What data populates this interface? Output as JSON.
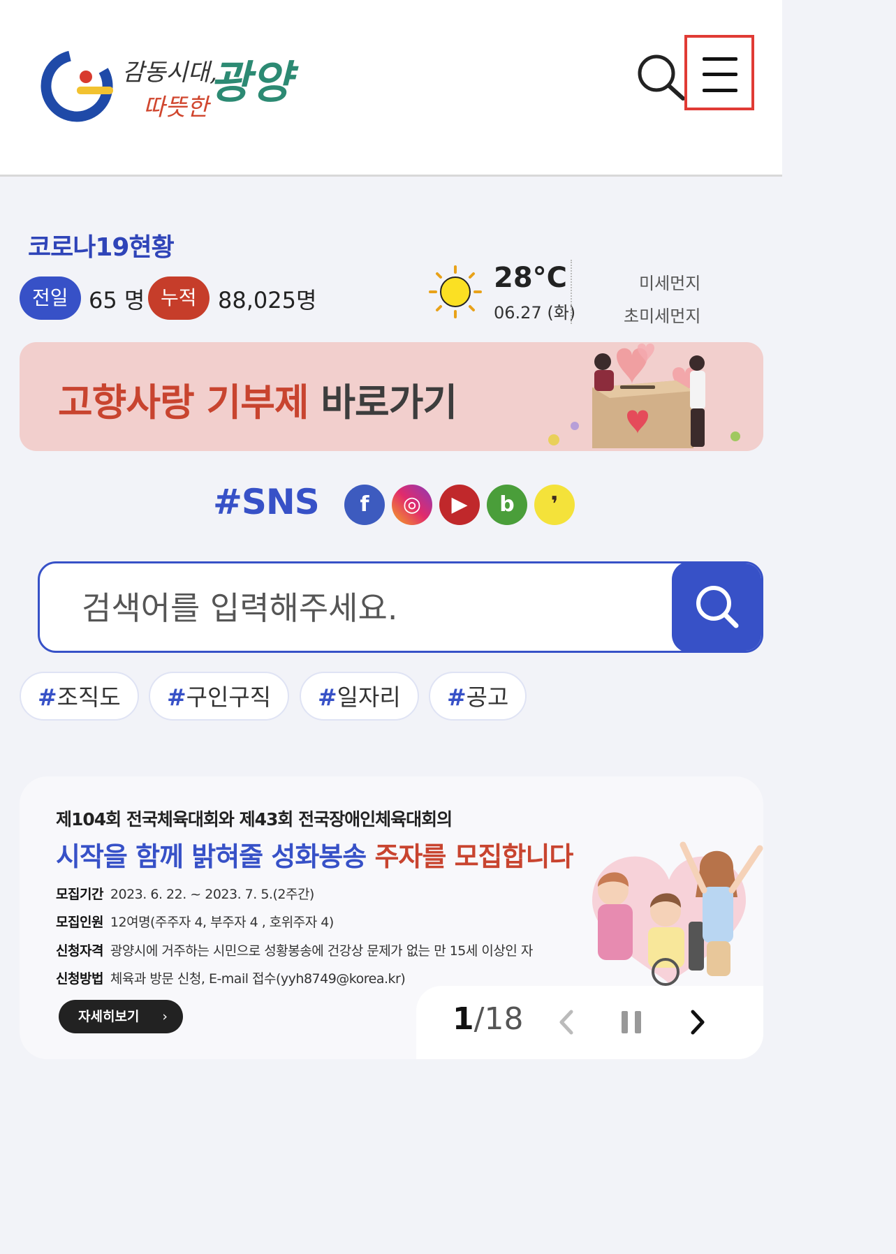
{
  "header": {
    "logo_text": "감동시대, 따뜻한 광양"
  },
  "covid": {
    "title": "코로나19현황",
    "prev_label": "전일",
    "prev_value": "65 명",
    "total_label": "누적",
    "total_value": "88,025명"
  },
  "weather": {
    "temp": "28°C",
    "date": "06.27 (화)",
    "fine_dust_label": "미세먼지",
    "ultra_fine_dust_label": "초미세먼지"
  },
  "gohyang_banner": {
    "text_red": "고향사랑 기부제",
    "text_gray": " 바로가기"
  },
  "sns": {
    "title": "#SNS",
    "items": [
      {
        "name": "facebook",
        "glyph": "f"
      },
      {
        "name": "instagram",
        "glyph": "◎"
      },
      {
        "name": "youtube",
        "glyph": "▶"
      },
      {
        "name": "blog",
        "glyph": "b"
      },
      {
        "name": "kakao",
        "glyph": "❜"
      }
    ]
  },
  "search": {
    "placeholder": "검색어를 입력해주세요."
  },
  "tags": [
    {
      "hash": "#",
      "label": "조직도"
    },
    {
      "hash": "#",
      "label": "구인구직"
    },
    {
      "hash": "#",
      "label": "일자리"
    },
    {
      "hash": "#",
      "label": "공고"
    }
  ],
  "main_banner": {
    "subtitle": "제104회 전국체육대회와 제43회 전국장애인체육대회의",
    "title_blue": "시작을 함께 밝혀줄 성화봉송 ",
    "title_red": "주자를 모집합니다",
    "rows": [
      {
        "label": "모집기간",
        "value": "2023. 6. 22. ~ 2023. 7. 5.(2주간)"
      },
      {
        "label": "모집인원",
        "value": "12여명(주주자 4, 부주자 4 , 호위주자 4)"
      },
      {
        "label": "신청자격",
        "value": "광양시에 거주하는 시민으로 성황봉송에 건강상 문제가 없는 만 15세 이상인 자"
      },
      {
        "label": "신청방법",
        "value": "체육과 방문 신청, E-mail 접수(yyh8749@korea.kr)"
      }
    ],
    "more_label": "자세히보기",
    "more_chevron": "›"
  },
  "pager": {
    "current": "1",
    "separator": "/",
    "total": "18"
  },
  "colors": {
    "primary_blue": "#3751c7",
    "accent_red": "#c63d2a",
    "highlight_red": "#e03b35"
  }
}
